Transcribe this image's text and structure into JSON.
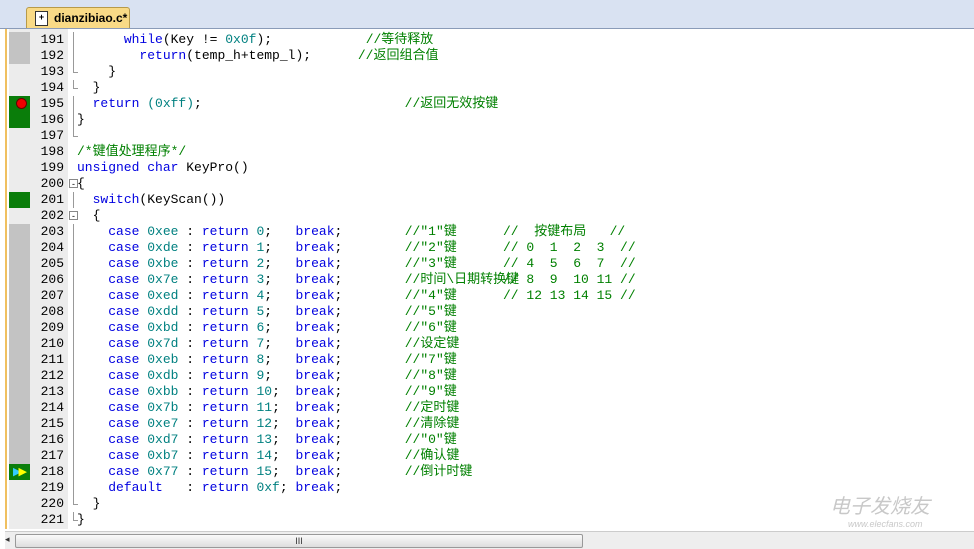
{
  "tab": {
    "filename": "dianzibiao.c*"
  },
  "watermark": {
    "brand": "电子发烧友",
    "url": "www.elecfans.com"
  },
  "scrollbar": {
    "grip": "III",
    "left_arrow": "◂"
  },
  "lines": [
    {
      "n": "191",
      "mark": "gray",
      "fold": "line",
      "segs": [
        [
          "",
          "      "
        ],
        [
          "kw",
          "while"
        ],
        [
          "",
          "(Key != "
        ],
        [
          "nm",
          "0x0f"
        ],
        [
          "",
          ");            "
        ],
        [
          "cm",
          "//等待释放"
        ]
      ]
    },
    {
      "n": "192",
      "mark": "gray",
      "fold": "line",
      "segs": [
        [
          "",
          "        "
        ],
        [
          "kw",
          "return"
        ],
        [
          "",
          "(temp_h+temp_l);      "
        ],
        [
          "cm",
          "//返回组合值"
        ]
      ]
    },
    {
      "n": "193",
      "mark": "",
      "fold": "end",
      "segs": [
        [
          "",
          "    }"
        ]
      ]
    },
    {
      "n": "194",
      "mark": "",
      "fold": "end",
      "segs": [
        [
          "",
          "  }"
        ]
      ]
    },
    {
      "n": "195",
      "mark": "green",
      "icon": "breakpoint",
      "fold": "line",
      "segs": [
        [
          "",
          "  "
        ],
        [
          "kw",
          "return"
        ],
        [
          "nm",
          " (0xff)"
        ],
        [
          "",
          ";                          "
        ],
        [
          "cm",
          "//返回无效按键"
        ]
      ]
    },
    {
      "n": "196",
      "mark": "green",
      "fold": "line",
      "segs": [
        [
          "",
          "}"
        ]
      ]
    },
    {
      "n": "197",
      "mark": "",
      "fold": "end",
      "segs": [
        [
          "",
          ""
        ]
      ]
    },
    {
      "n": "198",
      "mark": "",
      "fold": "",
      "segs": [
        [
          "cm",
          "/*键值处理程序*/"
        ]
      ]
    },
    {
      "n": "199",
      "mark": "",
      "fold": "",
      "segs": [
        [
          "kw",
          "unsigned char"
        ],
        [
          "",
          " KeyPro()"
        ]
      ]
    },
    {
      "n": "200",
      "mark": "",
      "fold": "box",
      "segs": [
        [
          "",
          "{"
        ]
      ]
    },
    {
      "n": "201",
      "mark": "green",
      "fold": "line",
      "segs": [
        [
          "",
          "  "
        ],
        [
          "kw",
          "switch"
        ],
        [
          "",
          "(KeyScan())"
        ]
      ]
    },
    {
      "n": "202",
      "mark": "",
      "fold": "box",
      "segs": [
        [
          "",
          "  {"
        ]
      ]
    },
    {
      "n": "203",
      "mark": "gray",
      "fold": "line",
      "segs": [
        [
          "",
          "    "
        ],
        [
          "kw",
          "case"
        ],
        [
          "nm",
          " 0xee"
        ],
        [
          "",
          " : "
        ],
        [
          "kw",
          "return"
        ],
        [
          "nm",
          " 0"
        ],
        [
          "",
          ";   "
        ],
        [
          "kw",
          "break"
        ],
        [
          "",
          ";        "
        ],
        [
          "cm",
          "//\"1\"键"
        ]
      ],
      "c2": "//  按键布局   //"
    },
    {
      "n": "204",
      "mark": "gray",
      "fold": "line",
      "segs": [
        [
          "",
          "    "
        ],
        [
          "kw",
          "case"
        ],
        [
          "nm",
          " 0xde"
        ],
        [
          "",
          " : "
        ],
        [
          "kw",
          "return"
        ],
        [
          "nm",
          " 1"
        ],
        [
          "",
          ";   "
        ],
        [
          "kw",
          "break"
        ],
        [
          "",
          ";        "
        ],
        [
          "cm",
          "//\"2\"键"
        ]
      ],
      "c2": "// 0  1  2  3  //"
    },
    {
      "n": "205",
      "mark": "gray",
      "fold": "line",
      "segs": [
        [
          "",
          "    "
        ],
        [
          "kw",
          "case"
        ],
        [
          "nm",
          " 0xbe"
        ],
        [
          "",
          " : "
        ],
        [
          "kw",
          "return"
        ],
        [
          "nm",
          " 2"
        ],
        [
          "",
          ";   "
        ],
        [
          "kw",
          "break"
        ],
        [
          "",
          ";        "
        ],
        [
          "cm",
          "//\"3\"键"
        ]
      ],
      "c2": "// 4  5  6  7  //"
    },
    {
      "n": "206",
      "mark": "gray",
      "fold": "line",
      "segs": [
        [
          "",
          "    "
        ],
        [
          "kw",
          "case"
        ],
        [
          "nm",
          " 0x7e"
        ],
        [
          "",
          " : "
        ],
        [
          "kw",
          "return"
        ],
        [
          "nm",
          " 3"
        ],
        [
          "",
          ";   "
        ],
        [
          "kw",
          "break"
        ],
        [
          "",
          ";        "
        ],
        [
          "cm",
          "//时间\\日期转换键"
        ]
      ],
      "c2": "// 8  9  10 11 //"
    },
    {
      "n": "207",
      "mark": "gray",
      "fold": "line",
      "segs": [
        [
          "",
          "    "
        ],
        [
          "kw",
          "case"
        ],
        [
          "nm",
          " 0xed"
        ],
        [
          "",
          " : "
        ],
        [
          "kw",
          "return"
        ],
        [
          "nm",
          " 4"
        ],
        [
          "",
          ";   "
        ],
        [
          "kw",
          "break"
        ],
        [
          "",
          ";        "
        ],
        [
          "cm",
          "//\"4\"键"
        ]
      ],
      "c2": "// 12 13 14 15 //"
    },
    {
      "n": "208",
      "mark": "gray",
      "fold": "line",
      "segs": [
        [
          "",
          "    "
        ],
        [
          "kw",
          "case"
        ],
        [
          "nm",
          " 0xdd"
        ],
        [
          "",
          " : "
        ],
        [
          "kw",
          "return"
        ],
        [
          "nm",
          " 5"
        ],
        [
          "",
          ";   "
        ],
        [
          "kw",
          "break"
        ],
        [
          "",
          ";        "
        ],
        [
          "cm",
          "//\"5\"键"
        ]
      ]
    },
    {
      "n": "209",
      "mark": "gray",
      "fold": "line",
      "segs": [
        [
          "",
          "    "
        ],
        [
          "kw",
          "case"
        ],
        [
          "nm",
          " 0xbd"
        ],
        [
          "",
          " : "
        ],
        [
          "kw",
          "return"
        ],
        [
          "nm",
          " 6"
        ],
        [
          "",
          ";   "
        ],
        [
          "kw",
          "break"
        ],
        [
          "",
          ";        "
        ],
        [
          "cm",
          "//\"6\"键"
        ]
      ]
    },
    {
      "n": "210",
      "mark": "gray",
      "fold": "line",
      "segs": [
        [
          "",
          "    "
        ],
        [
          "kw",
          "case"
        ],
        [
          "nm",
          " 0x7d"
        ],
        [
          "",
          " : "
        ],
        [
          "kw",
          "return"
        ],
        [
          "nm",
          " 7"
        ],
        [
          "",
          ";   "
        ],
        [
          "kw",
          "break"
        ],
        [
          "",
          ";        "
        ],
        [
          "cm",
          "//设定键"
        ]
      ]
    },
    {
      "n": "211",
      "mark": "gray",
      "fold": "line",
      "segs": [
        [
          "",
          "    "
        ],
        [
          "kw",
          "case"
        ],
        [
          "nm",
          " 0xeb"
        ],
        [
          "",
          " : "
        ],
        [
          "kw",
          "return"
        ],
        [
          "nm",
          " 8"
        ],
        [
          "",
          ";   "
        ],
        [
          "kw",
          "break"
        ],
        [
          "",
          ";        "
        ],
        [
          "cm",
          "//\"7\"键"
        ]
      ]
    },
    {
      "n": "212",
      "mark": "gray",
      "fold": "line",
      "segs": [
        [
          "",
          "    "
        ],
        [
          "kw",
          "case"
        ],
        [
          "nm",
          " 0xdb"
        ],
        [
          "",
          " : "
        ],
        [
          "kw",
          "return"
        ],
        [
          "nm",
          " 9"
        ],
        [
          "",
          ";   "
        ],
        [
          "kw",
          "break"
        ],
        [
          "",
          ";        "
        ],
        [
          "cm",
          "//\"8\"键"
        ]
      ]
    },
    {
      "n": "213",
      "mark": "gray",
      "fold": "line",
      "segs": [
        [
          "",
          "    "
        ],
        [
          "kw",
          "case"
        ],
        [
          "nm",
          " 0xbb"
        ],
        [
          "",
          " : "
        ],
        [
          "kw",
          "return"
        ],
        [
          "nm",
          " 10"
        ],
        [
          "",
          ";  "
        ],
        [
          "kw",
          "break"
        ],
        [
          "",
          ";        "
        ],
        [
          "cm",
          "//\"9\"键"
        ]
      ]
    },
    {
      "n": "214",
      "mark": "gray",
      "fold": "line",
      "segs": [
        [
          "",
          "    "
        ],
        [
          "kw",
          "case"
        ],
        [
          "nm",
          " 0x7b"
        ],
        [
          "",
          " : "
        ],
        [
          "kw",
          "return"
        ],
        [
          "nm",
          " 11"
        ],
        [
          "",
          ";  "
        ],
        [
          "kw",
          "break"
        ],
        [
          "",
          ";        "
        ],
        [
          "cm",
          "//定时键"
        ]
      ]
    },
    {
      "n": "215",
      "mark": "gray",
      "fold": "line",
      "segs": [
        [
          "",
          "    "
        ],
        [
          "kw",
          "case"
        ],
        [
          "nm",
          " 0xe7"
        ],
        [
          "",
          " : "
        ],
        [
          "kw",
          "return"
        ],
        [
          "nm",
          " 12"
        ],
        [
          "",
          ";  "
        ],
        [
          "kw",
          "break"
        ],
        [
          "",
          ";        "
        ],
        [
          "cm",
          "//清除键"
        ]
      ]
    },
    {
      "n": "216",
      "mark": "gray",
      "fold": "line",
      "segs": [
        [
          "",
          "    "
        ],
        [
          "kw",
          "case"
        ],
        [
          "nm",
          " 0xd7"
        ],
        [
          "",
          " : "
        ],
        [
          "kw",
          "return"
        ],
        [
          "nm",
          " 13"
        ],
        [
          "",
          ";  "
        ],
        [
          "kw",
          "break"
        ],
        [
          "",
          ";        "
        ],
        [
          "cm",
          "//\"0\"键"
        ]
      ]
    },
    {
      "n": "217",
      "mark": "gray",
      "fold": "line",
      "segs": [
        [
          "",
          "    "
        ],
        [
          "kw",
          "case"
        ],
        [
          "nm",
          " 0xb7"
        ],
        [
          "",
          " : "
        ],
        [
          "kw",
          "return"
        ],
        [
          "nm",
          " 14"
        ],
        [
          "",
          ";  "
        ],
        [
          "kw",
          "break"
        ],
        [
          "",
          ";        "
        ],
        [
          "cm",
          "//确认键"
        ]
      ]
    },
    {
      "n": "218",
      "mark": "green",
      "icon": "current-line",
      "fold": "line",
      "segs": [
        [
          "",
          "    "
        ],
        [
          "kw",
          "case"
        ],
        [
          "nm",
          " 0x77"
        ],
        [
          "",
          " : "
        ],
        [
          "kw",
          "return"
        ],
        [
          "nm",
          " 15"
        ],
        [
          "",
          ";  "
        ],
        [
          "kw",
          "break"
        ],
        [
          "",
          ";        "
        ],
        [
          "cm",
          "//倒计时键"
        ]
      ]
    },
    {
      "n": "219",
      "mark": "",
      "fold": "line",
      "segs": [
        [
          "",
          "    "
        ],
        [
          "kw",
          "default"
        ],
        [
          "",
          "   : "
        ],
        [
          "kw",
          "return"
        ],
        [
          "nm",
          " 0xf"
        ],
        [
          "",
          "; "
        ],
        [
          "kw",
          "break"
        ],
        [
          "",
          ";"
        ]
      ]
    },
    {
      "n": "220",
      "mark": "",
      "fold": "end",
      "segs": [
        [
          "",
          "  }"
        ]
      ]
    },
    {
      "n": "221",
      "mark": "",
      "fold": "end",
      "segs": [
        [
          "",
          "}"
        ]
      ]
    }
  ]
}
